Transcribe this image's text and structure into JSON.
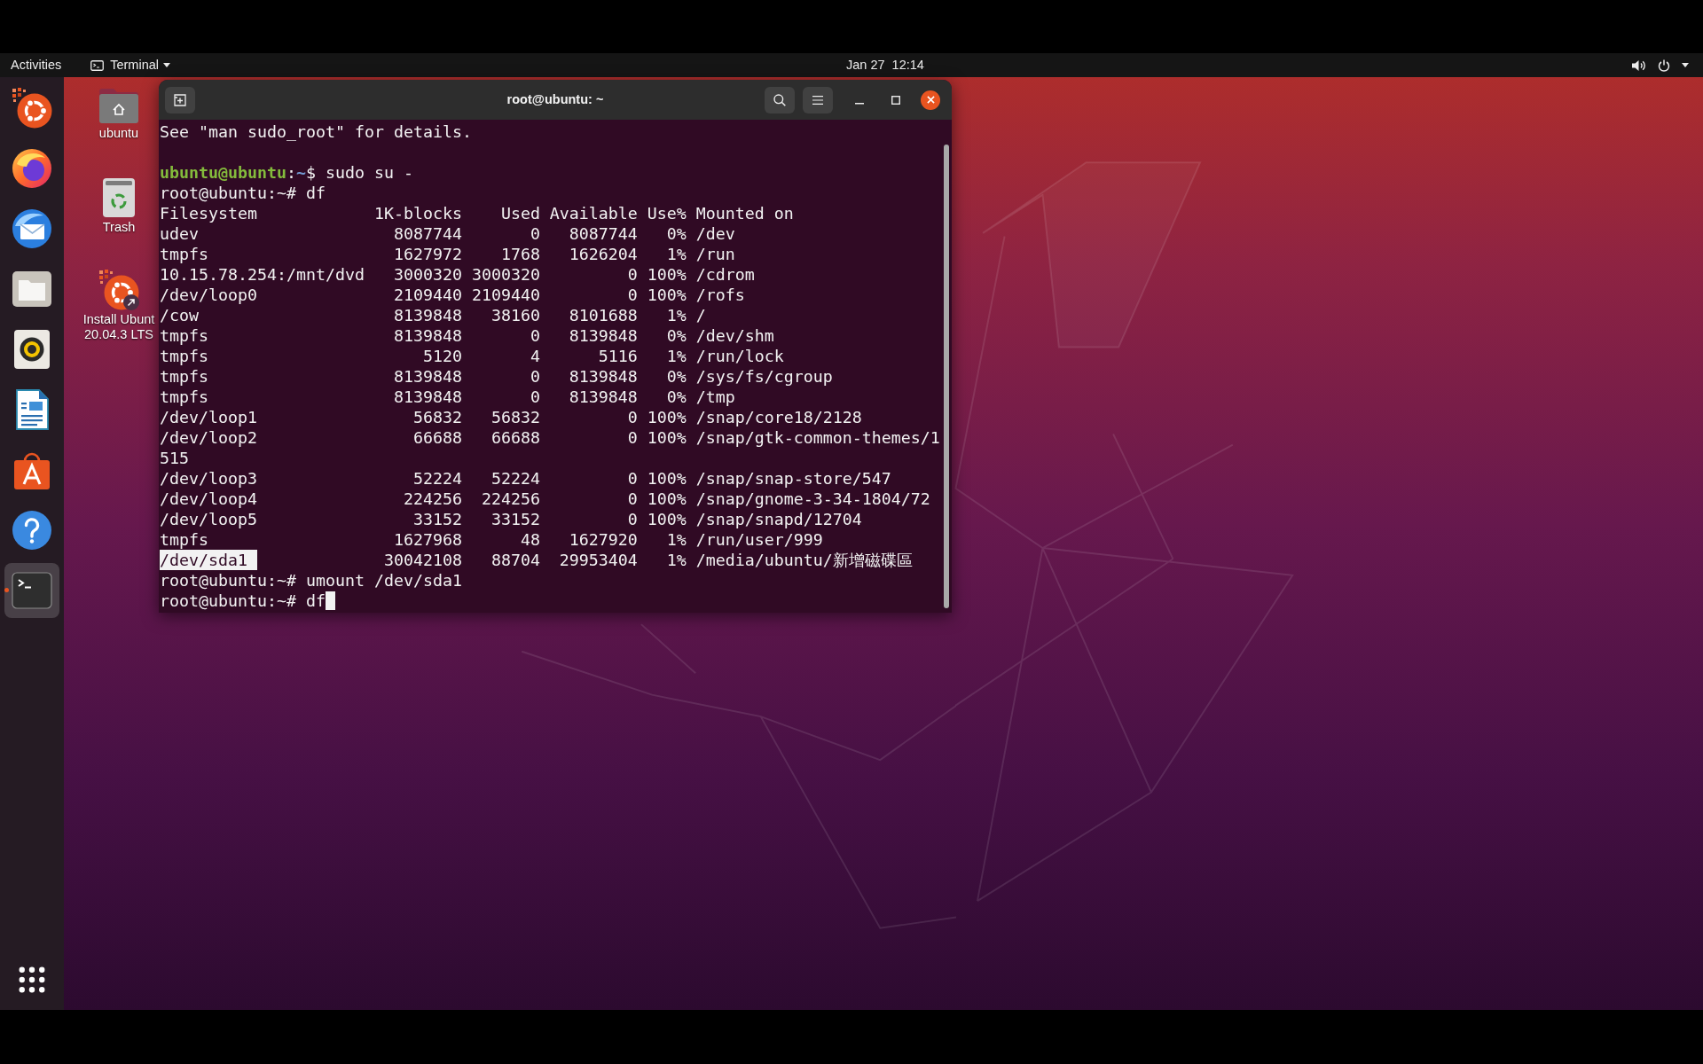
{
  "top_bar": {
    "activities": "Activities",
    "app_menu": "Terminal",
    "clock": "Jan 27  12:14"
  },
  "dock": {
    "items": [
      {
        "kind": "installer",
        "running": false,
        "focused": false
      },
      {
        "kind": "browser",
        "running": false,
        "focused": false
      },
      {
        "kind": "mail",
        "running": false,
        "focused": false
      },
      {
        "kind": "files",
        "running": false,
        "focused": false
      },
      {
        "kind": "music",
        "running": false,
        "focused": false
      },
      {
        "kind": "writer",
        "running": false,
        "focused": false
      },
      {
        "kind": "software",
        "running": false,
        "focused": false
      },
      {
        "kind": "help",
        "running": false,
        "focused": false
      },
      {
        "kind": "terminal",
        "running": true,
        "focused": true
      }
    ]
  },
  "desktop_icons": [
    {
      "kind": "home",
      "label_lines": [
        "ubuntu"
      ],
      "shortcut": false
    },
    {
      "kind": "trash",
      "label_lines": [
        "Trash"
      ],
      "shortcut": false
    },
    {
      "kind": "installer",
      "label_lines": [
        "Install Ubunt",
        "20.04.3 LTS"
      ],
      "shortcut": true
    }
  ],
  "terminal": {
    "title": "root@ubuntu: ~",
    "lines": [
      {
        "kind": "output",
        "text": "See \"man sudo_root\" for details."
      },
      {
        "kind": "blank"
      },
      {
        "kind": "styled",
        "segments": [
          {
            "kind": "user",
            "text": "ubuntu@ubuntu"
          },
          {
            "kind": "plain",
            "text": ":"
          },
          {
            "kind": "path",
            "text": "~"
          },
          {
            "kind": "plain",
            "text": "$ sudo su -"
          }
        ]
      },
      {
        "kind": "output",
        "text": "root@ubuntu:~# df"
      },
      {
        "kind": "output",
        "text": "Filesystem            1K-blocks    Used Available Use% Mounted on"
      },
      {
        "kind": "output",
        "text": "udev                    8087744       0   8087744   0% /dev"
      },
      {
        "kind": "output",
        "text": "tmpfs                   1627972    1768   1626204   1% /run"
      },
      {
        "kind": "output",
        "text": "10.15.78.254:/mnt/dvd   3000320 3000320         0 100% /cdrom"
      },
      {
        "kind": "output",
        "text": "/dev/loop0              2109440 2109440         0 100% /rofs"
      },
      {
        "kind": "output",
        "text": "/cow                    8139848   38160   8101688   1% /"
      },
      {
        "kind": "output",
        "text": "tmpfs                   8139848       0   8139848   0% /dev/shm"
      },
      {
        "kind": "output",
        "text": "tmpfs                      5120       4      5116   1% /run/lock"
      },
      {
        "kind": "output",
        "text": "tmpfs                   8139848       0   8139848   0% /sys/fs/cgroup"
      },
      {
        "kind": "output",
        "text": "tmpfs                   8139848       0   8139848   0% /tmp"
      },
      {
        "kind": "output",
        "text": "/dev/loop1                56832   56832         0 100% /snap/core18/2128"
      },
      {
        "kind": "output",
        "text": "/dev/loop2                66688   66688         0 100% /snap/gtk-common-themes/1"
      },
      {
        "kind": "output",
        "text": "515"
      },
      {
        "kind": "output",
        "text": "/dev/loop3                52224   52224         0 100% /snap/snap-store/547"
      },
      {
        "kind": "output",
        "text": "/dev/loop4               224256  224256         0 100% /snap/gnome-3-34-1804/72"
      },
      {
        "kind": "output",
        "text": "/dev/loop5                33152   33152         0 100% /snap/snapd/12704"
      },
      {
        "kind": "output",
        "text": "tmpfs                   1627968      48   1627920   1% /run/user/999"
      },
      {
        "kind": "styled",
        "segments": [
          {
            "kind": "plain",
            "text": "/dev/sda1 ",
            "selected": true
          },
          {
            "kind": "plain",
            "text": "             30042108   88704  29953404   1% /media/ubuntu/新增磁碟區",
            "selected": false
          }
        ]
      },
      {
        "kind": "output",
        "text": "root@ubuntu:~# umount /dev/sda1"
      },
      {
        "kind": "output",
        "text": "root@ubuntu:~# df",
        "cursor": true
      }
    ]
  }
}
